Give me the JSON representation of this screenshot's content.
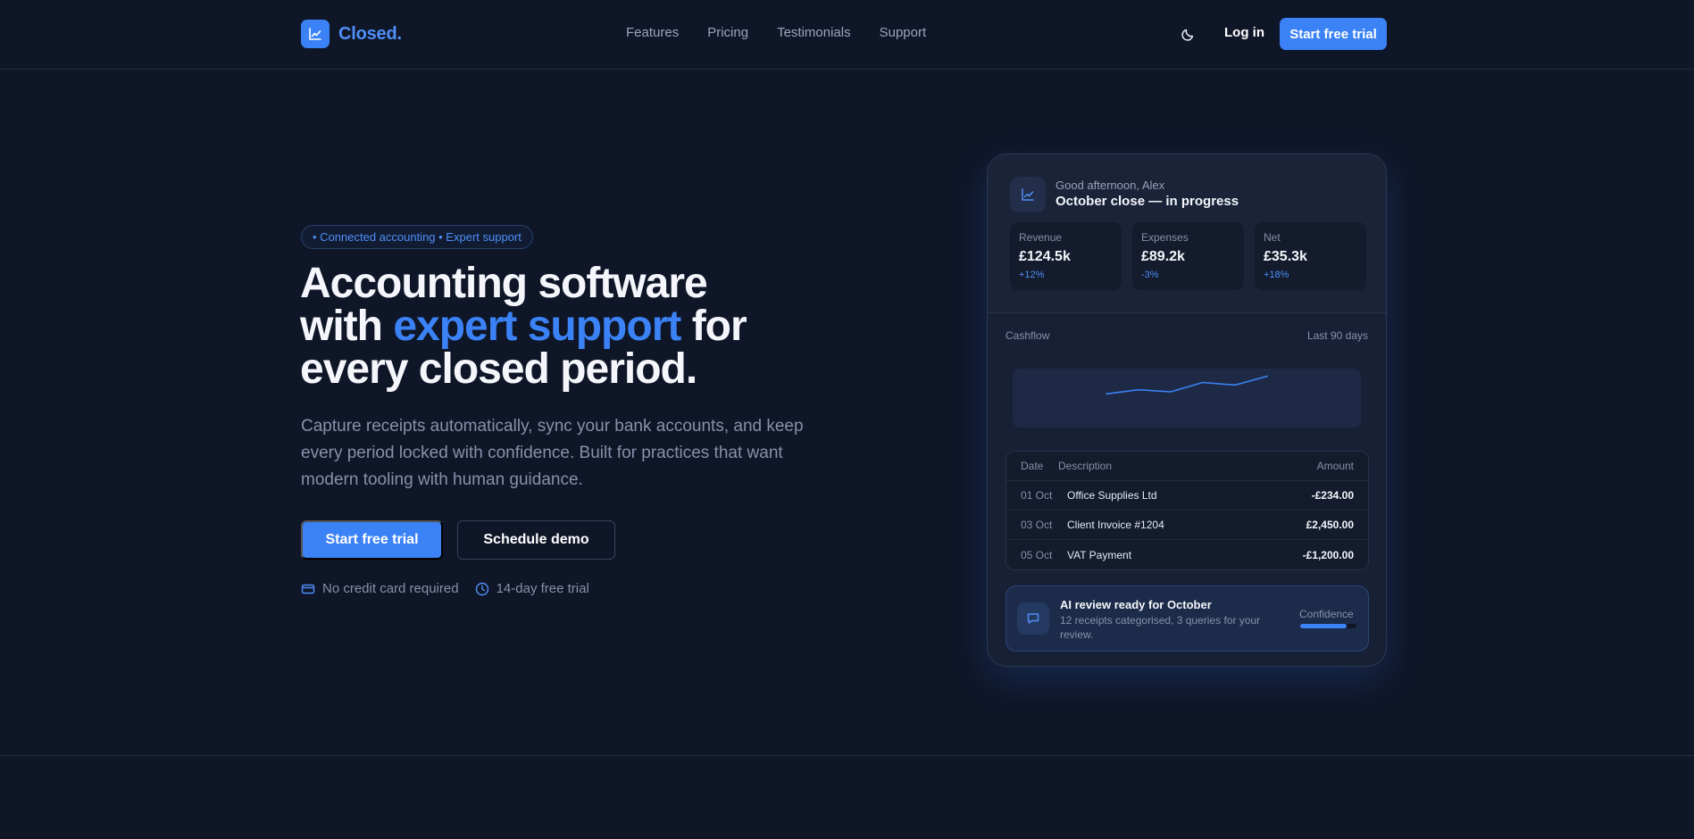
{
  "brand": {
    "name": "Closed.",
    "icon": "chart-line-icon",
    "accent": "#3b82f6"
  },
  "nav": [
    "Features",
    "Pricing",
    "Testimonials",
    "Support"
  ],
  "header": {
    "theme_icon": "moon-icon",
    "login": "Log in",
    "cta": "Start free trial"
  },
  "hero": {
    "badge": "• Connected accounting • Expert support",
    "headline_pre": "Accounting software",
    "headline_with": "with ",
    "headline_accent": "expert support",
    "headline_for": " for",
    "headline_post": "every closed period.",
    "subtext": "Capture receipts automatically, sync your bank accounts, and keep every period locked with confidence. Built for practices that want modern tooling with human guidance.",
    "primary_cta": "Start free trial",
    "secondary_cta": "Schedule demo",
    "perks": [
      {
        "icon": "credit-card-icon",
        "label": "No credit card required"
      },
      {
        "icon": "clock-icon",
        "label": "14-day free trial"
      }
    ]
  },
  "dashboard": {
    "greeting": "Good afternoon, Alex",
    "title": "October close — in progress",
    "stats": [
      {
        "label": "Revenue",
        "value": "£124.5k",
        "change": "+12%"
      },
      {
        "label": "Expenses",
        "value": "£89.2k",
        "change": "-3%"
      },
      {
        "label": "Net",
        "value": "£35.3k",
        "change": "+18%"
      }
    ],
    "cashflow": {
      "label": "Cashflow",
      "range": "Last 90 days",
      "line_color": "#3b82f6",
      "values": [
        20,
        28,
        24,
        42,
        37,
        54
      ]
    },
    "transactions": {
      "headers": {
        "date": "Date",
        "description": "Description",
        "amount": "Amount"
      },
      "rows": [
        {
          "date": "01 Oct",
          "description": "Office Supplies Ltd",
          "amount": "-£234.00"
        },
        {
          "date": "03 Oct",
          "description": "Client Invoice #1204",
          "amount": "£2,450.00"
        },
        {
          "date": "05 Oct",
          "description": "VAT Payment",
          "amount": "-£1,200.00"
        }
      ]
    },
    "ai_review": {
      "icon": "message-square-icon",
      "title": "AI review ready for October",
      "description": "12 receipts categorised, 3 queries for your review.",
      "confidence_label": "Confidence",
      "confidence": 0.82
    }
  }
}
